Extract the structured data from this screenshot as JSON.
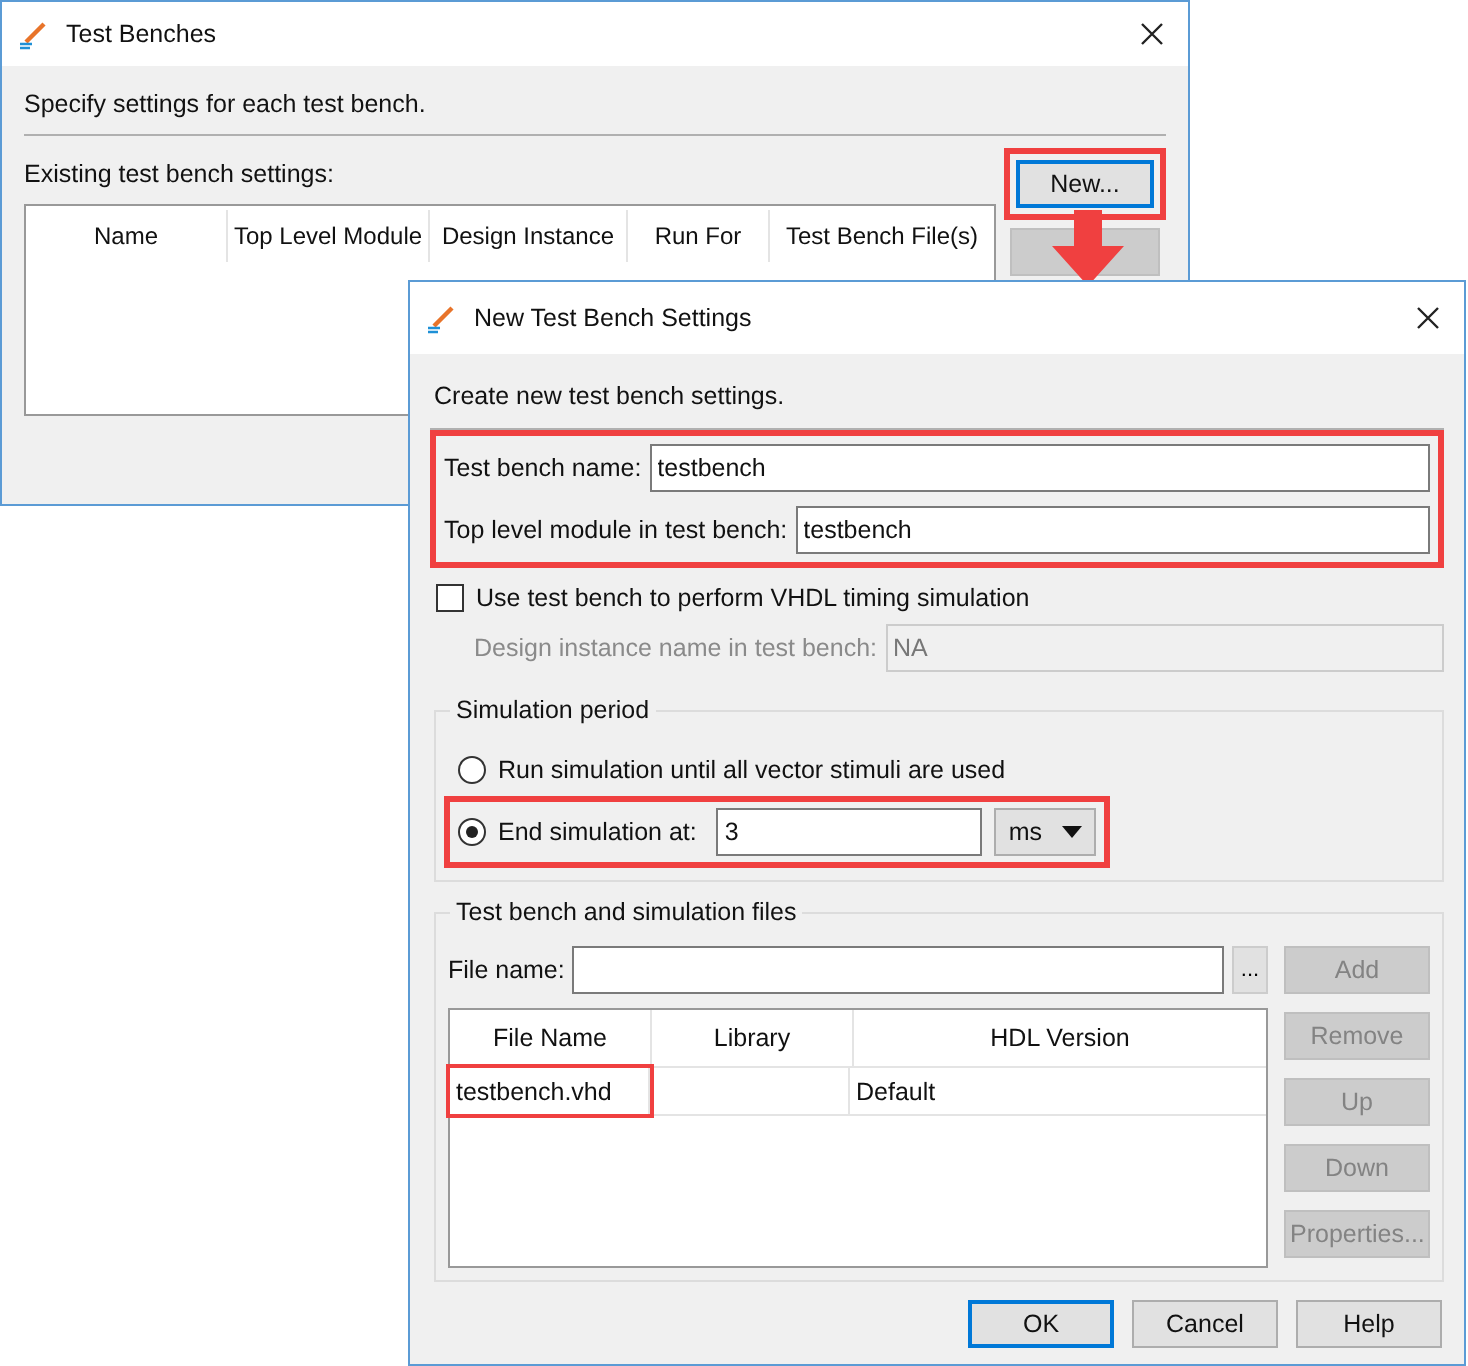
{
  "back_window": {
    "title": "Test Benches",
    "description": "Specify settings for each test bench.",
    "list_label": "Existing test bench settings:",
    "columns": [
      "Name",
      "Top Level Module",
      "Design Instance",
      "Run For",
      "Test Bench File(s)"
    ],
    "new_button": {
      "label": "New...",
      "focused": true,
      "highlighted": true
    },
    "button_2": {
      "disabled": true
    }
  },
  "front_window": {
    "title": "New Test Bench Settings",
    "description": "Create new test bench settings.",
    "name_fields": {
      "highlighted": true,
      "fields": [
        {
          "label": "Test bench name:",
          "value": "testbench"
        },
        {
          "label": "Top level module in test bench:",
          "value": "testbench"
        }
      ]
    },
    "timing_checkbox": {
      "label": "Use test bench to perform VHDL timing simulation",
      "checked": false
    },
    "design_instance": {
      "label": "Design instance name in test bench:",
      "value": "NA",
      "disabled": true
    },
    "simulation_period": {
      "title": "Simulation period",
      "options": [
        {
          "label": "Run simulation until all vector stimuli are used",
          "selected": false,
          "highlighted": false
        },
        {
          "label": "End simulation at:",
          "selected": true,
          "highlighted": true,
          "value": "3",
          "unit": "ms"
        }
      ]
    },
    "files": {
      "title": "Test bench and simulation files",
      "file_name_label": "File name:",
      "browse": "...",
      "columns": [
        "File Name",
        "Library",
        "HDL Version"
      ],
      "rows": [
        {
          "file_name": "testbench.vhd",
          "hdl_version": "Default",
          "highlighted": true
        }
      ],
      "side_buttons": [
        {
          "label": "Add",
          "disabled": true
        },
        {
          "label": "Remove",
          "disabled": true
        },
        {
          "label": "Up",
          "disabled": true
        },
        {
          "label": "Down",
          "disabled": true
        },
        {
          "label": "Properties...",
          "disabled": true
        }
      ]
    },
    "dialog_buttons": [
      {
        "label": "OK",
        "focused": true
      },
      {
        "label": "Cancel",
        "focused": false
      },
      {
        "label": "Help",
        "focused": false
      }
    ]
  }
}
